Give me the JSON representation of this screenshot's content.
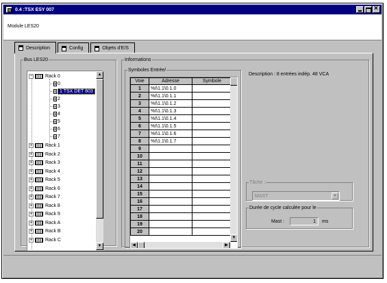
{
  "window": {
    "title": "0.4 :TSX ESY 007"
  },
  "header": {
    "module_label": "Module LES20"
  },
  "tabs": [
    {
      "label": "Description"
    },
    {
      "label": "Config"
    },
    {
      "label": "Objets d'E/S"
    }
  ],
  "bus_group": {
    "legend": "Bus LES20",
    "rack0_label": "Rack 0",
    "slots": [
      {
        "label": "0"
      },
      {
        "label": "1 TSX DET 803"
      },
      {
        "label": "2"
      },
      {
        "label": "3"
      },
      {
        "label": "4"
      },
      {
        "label": "5"
      },
      {
        "label": "6"
      },
      {
        "label": "7"
      }
    ],
    "racks": [
      "Rack 1",
      "Rack 2",
      "Rack 3",
      "Rack 4",
      "Rack 5",
      "Rack 6",
      "Rack 7",
      "Rack 8",
      "Rack 9",
      "Rack A",
      "Rack B",
      "Rack C"
    ]
  },
  "info_group": {
    "legend": "Informations",
    "symbols_legend": "Symboles Entrée/",
    "columns": [
      "Voie",
      "Adresse",
      "Symbole"
    ],
    "rows": [
      {
        "voie": "1",
        "adresse": "%I\\1.1\\0.1.0",
        "symbole": ""
      },
      {
        "voie": "2",
        "adresse": "%I\\1.1\\0.1.1",
        "symbole": ""
      },
      {
        "voie": "3",
        "adresse": "%I\\1.1\\0.1.2",
        "symbole": ""
      },
      {
        "voie": "4",
        "adresse": "%I\\1.1\\0.1.3",
        "symbole": ""
      },
      {
        "voie": "5",
        "adresse": "%I\\1.1\\0.1.4",
        "symbole": ""
      },
      {
        "voie": "6",
        "adresse": "%I\\1.1\\0.1.5",
        "symbole": ""
      },
      {
        "voie": "7",
        "adresse": "%I\\1.1\\0.1.6",
        "symbole": ""
      },
      {
        "voie": "8",
        "adresse": "%I\\1.1\\0.1.7",
        "symbole": ""
      },
      {
        "voie": "9",
        "adresse": "",
        "symbole": ""
      },
      {
        "voie": "10",
        "adresse": "",
        "symbole": ""
      },
      {
        "voie": "11",
        "adresse": "",
        "symbole": ""
      },
      {
        "voie": "12",
        "adresse": "",
        "symbole": ""
      },
      {
        "voie": "13",
        "adresse": "",
        "symbole": ""
      },
      {
        "voie": "14",
        "adresse": "",
        "symbole": ""
      },
      {
        "voie": "15",
        "adresse": "",
        "symbole": ""
      },
      {
        "voie": "16",
        "adresse": "",
        "symbole": ""
      },
      {
        "voie": "17",
        "adresse": "",
        "symbole": ""
      },
      {
        "voie": "18",
        "adresse": "",
        "symbole": ""
      },
      {
        "voie": "19",
        "adresse": "",
        "symbole": ""
      },
      {
        "voie": "20",
        "adresse": "",
        "symbole": ""
      }
    ],
    "description": "Description : 8 entrées indép. 48 VCA",
    "task": {
      "legend": "Tâche :",
      "value": "MAST"
    },
    "cycle": {
      "legend": "Durée de cycle calculée pour le",
      "label": "Mast :",
      "value": "1",
      "unit": "ms"
    }
  }
}
